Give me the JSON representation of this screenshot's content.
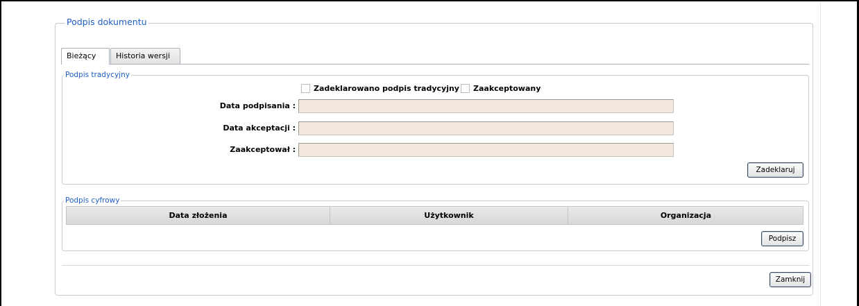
{
  "dialog": {
    "legend": "Podpis dokumentu",
    "tabs": [
      {
        "label": "Bieżący",
        "active": true
      },
      {
        "label": "Historia wersji",
        "active": false
      }
    ],
    "close_button": "Zamknij"
  },
  "traditional": {
    "legend": "Podpis tradycyjny",
    "checkboxes": [
      {
        "label": "Zadeklarowano podpis tradycyjny",
        "checked": false
      },
      {
        "label": "Zaakceptowany",
        "checked": false
      }
    ],
    "fields": [
      {
        "label": "Data podpisania :",
        "value": ""
      },
      {
        "label": "Data akceptacji :",
        "value": ""
      },
      {
        "label": "Zaakceptował :",
        "value": ""
      }
    ],
    "declare_button": "Zadeklaruj"
  },
  "digital": {
    "legend": "Podpis cyfrowy",
    "columns": [
      "Data złożenia",
      "Użytkownik",
      "Organizacja"
    ],
    "sign_button": "Podpisz"
  },
  "colors": {
    "legend_text": "#1f5ec7",
    "readonly_field_bg": "#f2e8dc"
  }
}
